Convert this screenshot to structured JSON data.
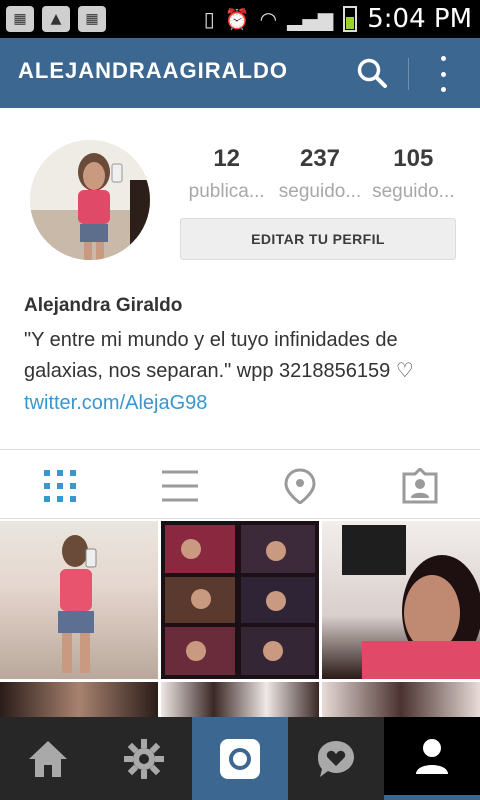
{
  "status_bar": {
    "time": "5:04 PM",
    "left_icons": [
      "bbm-notification-icon",
      "gallery-icon",
      "bbm-icon"
    ],
    "right_icons": [
      "vibrate-icon",
      "alarm-icon",
      "wifi-icon",
      "signal-icon",
      "battery-icon"
    ]
  },
  "app_bar": {
    "title": "ALEJANDRAAGIRALDO",
    "actions": [
      "search-icon",
      "more-vert-icon"
    ],
    "color": "#3c6791"
  },
  "profile": {
    "stats": [
      {
        "value": "12",
        "label": "publica..."
      },
      {
        "value": "237",
        "label": "seguido..."
      },
      {
        "value": "105",
        "label": "seguido..."
      }
    ],
    "edit_button": "EDITAR TU PERFIL",
    "full_name": "Alejandra Giraldo",
    "bio": "\"Y entre mi mundo y el tuyo infinidades de galaxias, nos separan.\" wpp 3218856159 ♡",
    "link": "twitter.com/AlejaG98"
  },
  "view_tabs": [
    {
      "icon": "grid-icon",
      "active": true
    },
    {
      "icon": "list-icon",
      "active": false
    },
    {
      "icon": "location-pin-icon",
      "active": false
    },
    {
      "icon": "tagged-photos-icon",
      "active": false
    }
  ],
  "bottom_nav": [
    {
      "icon": "home-icon",
      "active": false
    },
    {
      "icon": "explore-icon",
      "active": false
    },
    {
      "icon": "camera-icon",
      "active": false
    },
    {
      "icon": "activity-heart-icon",
      "active": false
    },
    {
      "icon": "profile-icon",
      "active": true
    }
  ],
  "colors": {
    "accent": "#3897cf",
    "nav_bg": "#272727",
    "camera_tab": "#3c6791"
  }
}
